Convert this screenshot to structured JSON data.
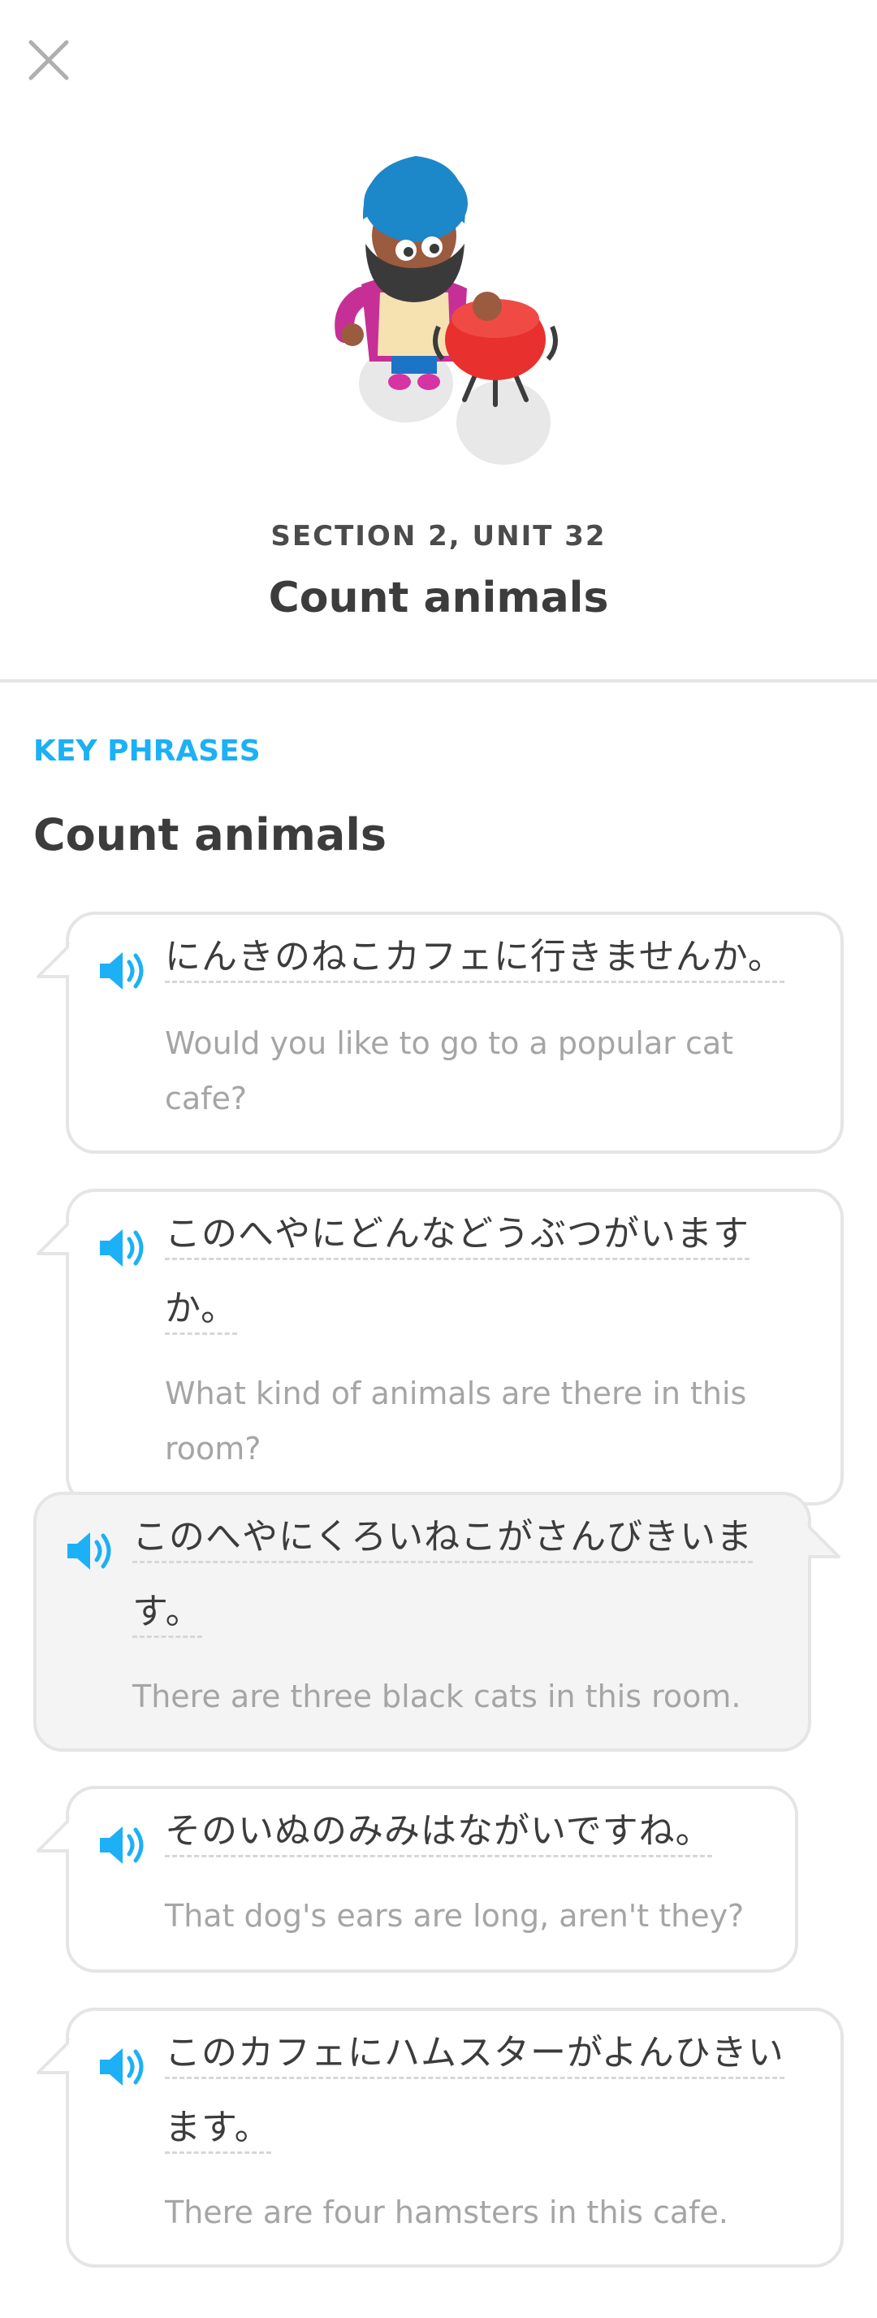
{
  "header": {
    "close_icon": "close-icon",
    "section_label": "SECTION 2, UNIT 32",
    "unit_title": "Count animals"
  },
  "key_phrases": {
    "heading": "KEY PHRASES",
    "title": "Count animals",
    "colors": {
      "accent": "#1cb0f6",
      "bubble_border": "#e5e5e5",
      "alt_bubble_bg": "#f4f4f5",
      "translation": "#a5a5a5"
    },
    "items": [
      {
        "icon": "speaker-icon",
        "jp": "にんきのねこカフェに行きませんか。",
        "en_line1": "Would you like to go to a popular cat",
        "en_line2": "cafe?"
      },
      {
        "icon": "speaker-icon",
        "jp_line1": "このへやにどんなどうぶつがいます",
        "jp_line2": "か。",
        "en_line1": "What kind of animals are there in this",
        "en_line2": "room?"
      },
      {
        "icon": "speaker-icon",
        "jp_line1": "このへやにくろいねこがさんびきいま",
        "jp_line2": "す。",
        "en": "There are three black cats in this room."
      },
      {
        "icon": "speaker-icon",
        "jp": "そのいぬのみみはながいですね。",
        "en": "That dog's ears are long, aren't they?"
      },
      {
        "icon": "speaker-icon",
        "jp_line1": "このカフェにハムスターがよんひきい",
        "jp_line2": "ます。",
        "en": "There are four hamsters in this cafe."
      }
    ]
  }
}
